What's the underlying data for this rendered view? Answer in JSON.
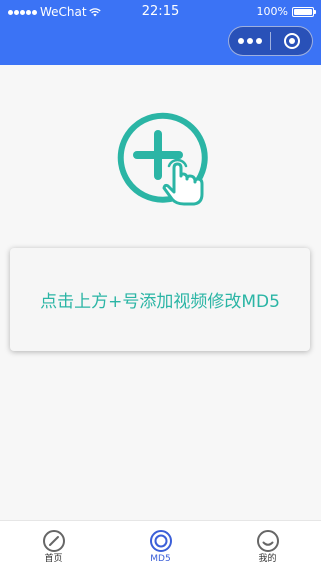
{
  "status_bar": {
    "carrier": "WeChat",
    "time": "22:15",
    "battery": "100%"
  },
  "capsule": {
    "more_icon": "more-dots-icon",
    "close_icon": "target-close-icon"
  },
  "main": {
    "add_icon": "add-tap-icon",
    "hint": "点击上方+号添加视频修改MD5"
  },
  "tabbar": {
    "active_color": "#3b5fd8",
    "tabs": [
      {
        "label": "首页",
        "icon": "compass-icon",
        "active": false
      },
      {
        "label": "MD5",
        "icon": "target-icon",
        "active": true
      },
      {
        "label": "我的",
        "icon": "smile-icon",
        "active": false
      }
    ]
  },
  "colors": {
    "header": "#3b73f5",
    "accent": "#2bb5a5",
    "background": "#f7f7f7"
  }
}
